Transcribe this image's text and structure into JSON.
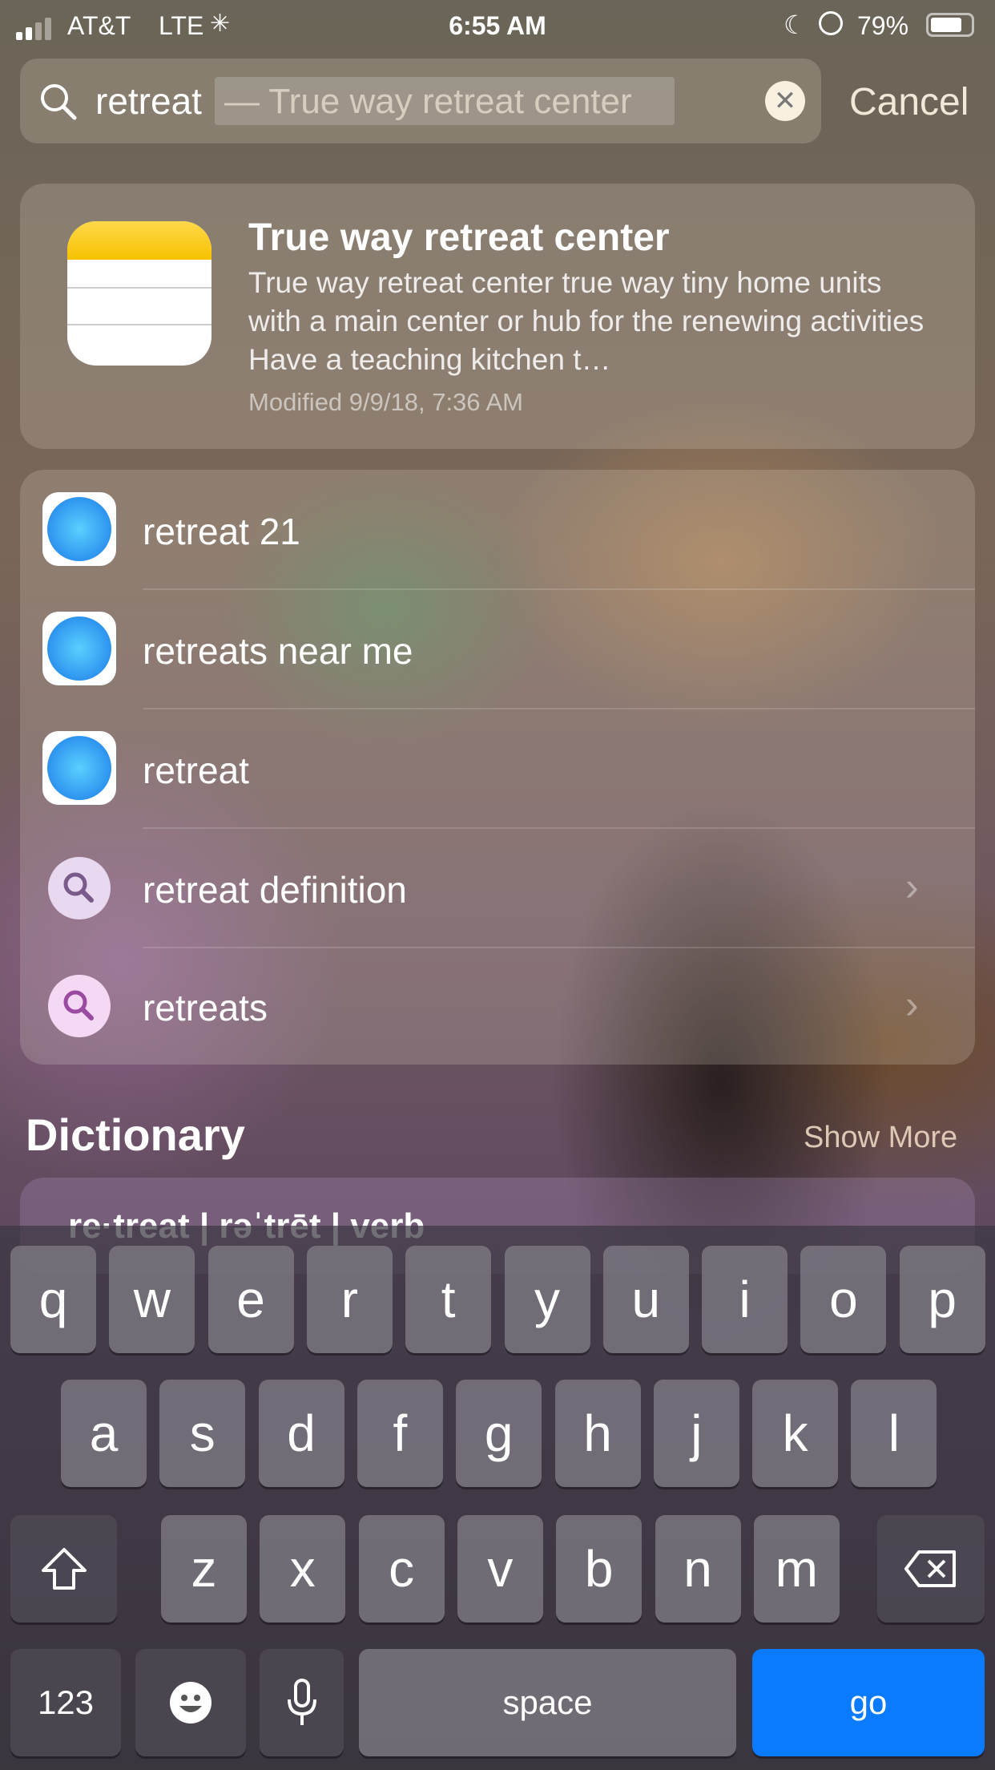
{
  "status": {
    "carrier": "AT&T",
    "network": "LTE",
    "time": "6:55 AM",
    "battery": "79%"
  },
  "search": {
    "query": "retreat",
    "suggestion": "— True way retreat center",
    "cancel": "Cancel"
  },
  "top_hit": {
    "title": "True way retreat center",
    "snippet": "True way retreat center  true way tiny home units with a main center or hub for the renewing activities Have a teaching kitchen t…",
    "modified": "Modified 9/9/18, 7:36 AM",
    "icon": "notes-icon"
  },
  "results": [
    {
      "label": "retreat 21",
      "icon": "safari-icon"
    },
    {
      "label": "retreats near me",
      "icon": "safari-icon"
    },
    {
      "label": "retreat",
      "icon": "safari-icon"
    },
    {
      "label": "retreat definition",
      "icon": "search-icon"
    },
    {
      "label": "retreats",
      "icon": "search-icon"
    }
  ],
  "dictionary": {
    "header": "Dictionary",
    "show_more": "Show More",
    "entry": "re·treat | rəˈtrēt | verb"
  },
  "keyboard": {
    "row1": [
      "q",
      "w",
      "e",
      "r",
      "t",
      "y",
      "u",
      "i",
      "o",
      "p"
    ],
    "row2": [
      "a",
      "s",
      "d",
      "f",
      "g",
      "h",
      "j",
      "k",
      "l"
    ],
    "row3": [
      "z",
      "x",
      "c",
      "v",
      "b",
      "n",
      "m"
    ],
    "numbers": "123",
    "space": "space",
    "go": "go"
  },
  "colors": {
    "go": "#0a7aff"
  }
}
